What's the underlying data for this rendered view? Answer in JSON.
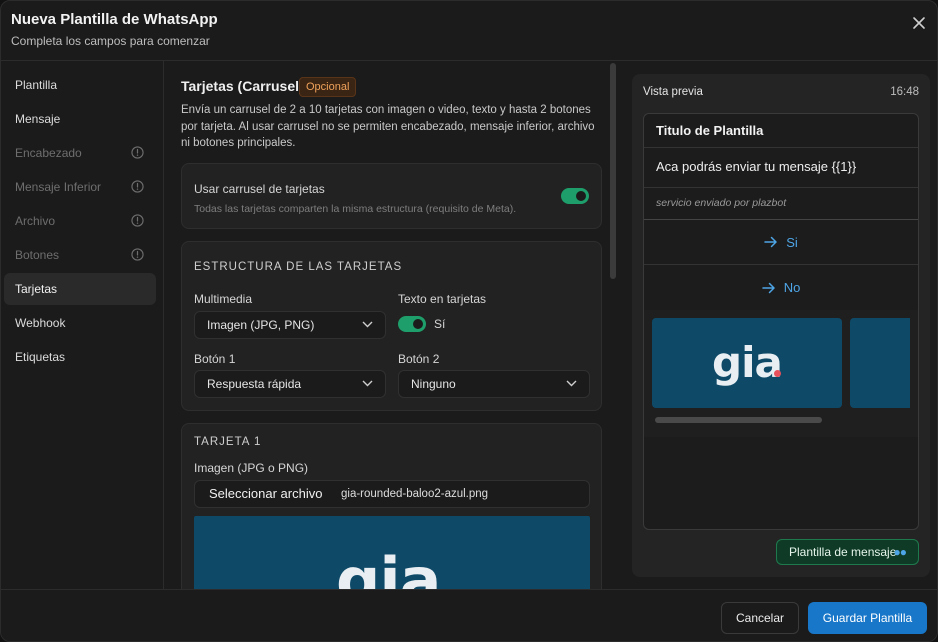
{
  "header": {
    "title": "Nueva Plantilla de WhatsApp",
    "subtitle": "Completa los campos para comenzar"
  },
  "sidebar": {
    "items": [
      {
        "label": "Plantilla",
        "state": "enabled"
      },
      {
        "label": "Mensaje",
        "state": "enabled"
      },
      {
        "label": "Encabezado",
        "state": "disabled",
        "icon": "warning-icon"
      },
      {
        "label": "Mensaje Inferior",
        "state": "disabled",
        "icon": "warning-icon"
      },
      {
        "label": "Archivo",
        "state": "disabled",
        "icon": "warning-icon"
      },
      {
        "label": "Botones",
        "state": "disabled",
        "icon": "warning-icon"
      },
      {
        "label": "Tarjetas",
        "state": "active"
      },
      {
        "label": "Webhook",
        "state": "enabled"
      },
      {
        "label": "Etiquetas",
        "state": "enabled"
      }
    ]
  },
  "main": {
    "section_title": "Tarjetas (Carrusel)",
    "badge": "Opcional",
    "description": "Envía un carrusel de 2 a 10 tarjetas con imagen o video, texto y hasta 2 botones por tarjeta. Al usar carrusel no se permiten encabezado, mensaje inferior, archivo ni botones principales.",
    "carousel_toggle": {
      "label": "Usar carrusel de tarjetas",
      "hint": "Todas las tarjetas comparten la misma estructura (requisito de Meta).",
      "on": true
    },
    "structure": {
      "heading": "ESTRUCTURA DE LAS TARJETAS",
      "media_label": "Multimedia",
      "media_value": "Imagen (JPG, PNG)",
      "text_label": "Texto en tarjetas",
      "text_value": "Sí",
      "text_on": true,
      "button1_label": "Botón 1",
      "button1_value": "Respuesta rápida",
      "button2_label": "Botón 2",
      "button2_value": "Ninguno"
    },
    "card1": {
      "heading": "TARJETA 1",
      "image_label": "Imagen (JPG o PNG)",
      "file_button": "Seleccionar archivo",
      "file_name": "gia-rounded-baloo2-azul.png",
      "logo_text": "gia"
    }
  },
  "preview": {
    "title": "Vista previa",
    "time": "16:48",
    "template_title": "Titulo de Plantilla",
    "body": "Aca podrás enviar tu mensaje {{1}}",
    "footer": "servicio enviado por plazbot",
    "buttons": [
      "Si",
      "No"
    ],
    "logo_text": "gia",
    "logo_dot_color": "#e8505b",
    "tag_button": "Plantilla de mensaje"
  },
  "footer": {
    "cancel": "Cancelar",
    "save": "Guardar Plantilla"
  },
  "colors": {
    "accent_green": "#1e9e6a",
    "accent_blue": "#1877c9",
    "card_blue": "#0e4a68",
    "badge_orange": "#f0a25a"
  }
}
